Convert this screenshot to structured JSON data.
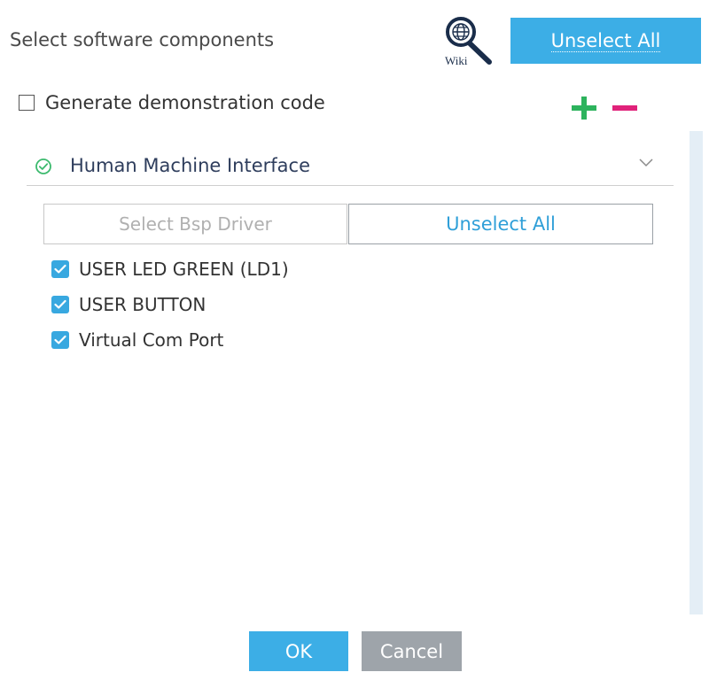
{
  "header": {
    "title": "Select software components",
    "wiki_label": "Wiki",
    "unselect_all_label": "Unselect All"
  },
  "options": {
    "demo_code_label": "Generate demonstration code",
    "demo_code_checked": false
  },
  "section": {
    "title": "Human Machine Interface",
    "status": "ok",
    "expanded": true,
    "select_bsp_label": "Select Bsp Driver",
    "unselect_all_label": "Unselect All",
    "drivers": [
      {
        "label": "USER LED GREEN (LD1)",
        "checked": true
      },
      {
        "label": "USER BUTTON",
        "checked": true
      },
      {
        "label": "Virtual Com Port",
        "checked": true
      }
    ]
  },
  "footer": {
    "ok_label": "OK",
    "cancel_label": "Cancel"
  },
  "colors": {
    "accent": "#3caee6",
    "check": "#38a8e0",
    "plus": "#2db35d",
    "minus": "#e0227a",
    "status_ok": "#3cba6e",
    "cancel": "#9ea4aa"
  },
  "icons": {
    "wiki": "wiki-magnifier-icon",
    "expand": "plus-icon",
    "collapse": "minus-icon",
    "section_status": "check-circle-icon",
    "section_toggle": "chevron-down-icon",
    "checkbox": "checkmark-icon"
  }
}
